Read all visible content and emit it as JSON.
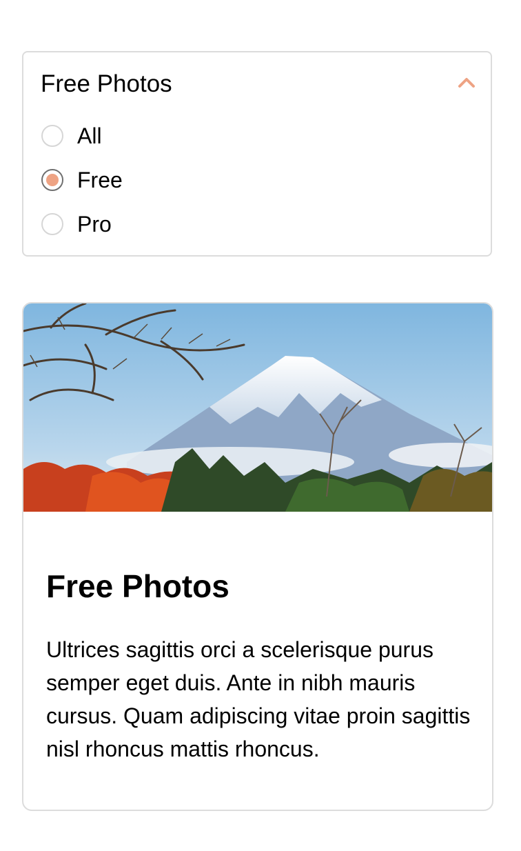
{
  "filter": {
    "title": "Free Photos",
    "toggle_icon": "chevron-up-icon",
    "options": [
      {
        "label": "All",
        "checked": false
      },
      {
        "label": "Free",
        "checked": true
      },
      {
        "label": "Pro",
        "checked": false
      }
    ]
  },
  "card": {
    "image_description": "mountain-landscape-image",
    "title": "Free Photos",
    "text": "Ultrices sagittis orci a scelerisque purus semper eget duis. Ante in nibh mauris cursus. Quam adipiscing vitae proin sagittis nisl rhoncus mattis rhoncus."
  },
  "colors": {
    "accent": "#eea384",
    "border": "#dcdcdc"
  }
}
